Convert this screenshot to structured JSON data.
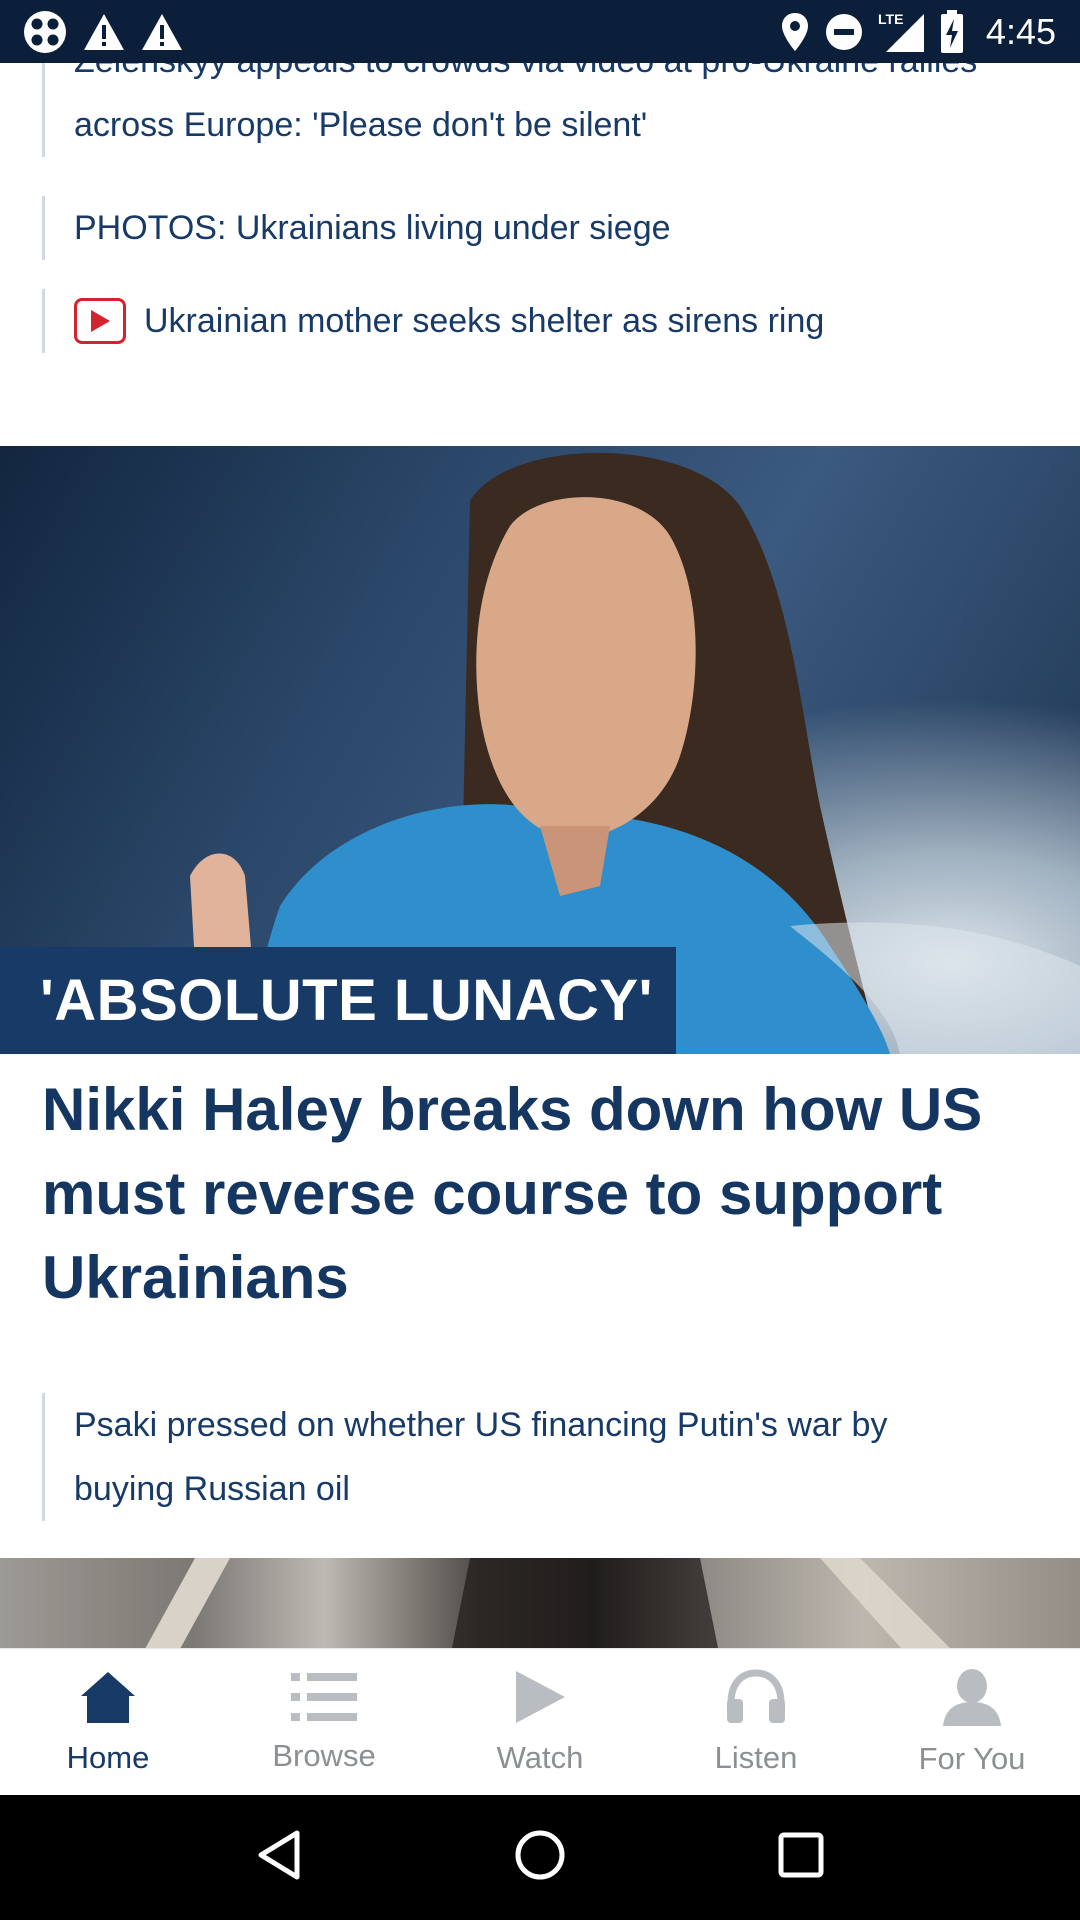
{
  "status_bar": {
    "time": "4:45",
    "network": "LTE",
    "icons": [
      "app-notification-icon",
      "warning-icon",
      "warning-icon",
      "location-icon",
      "do-not-disturb-icon",
      "signal-icon",
      "battery-charging-icon"
    ]
  },
  "related_top": [
    {
      "text": "Zelenskyy appeals to crowds via video at pro-Ukraine rallies across Europe: 'Please don't be silent'"
    },
    {
      "text": "PHOTOS: Ukrainians living under siege"
    },
    {
      "text": "Ukrainian mother seeks shelter as sirens ring",
      "icon": "video-play-icon"
    }
  ],
  "story": {
    "tag": "'ABSOLUTE LUNACY'",
    "headline": "Nikki Haley breaks down how US must reverse course to support Ukrainians",
    "related": [
      {
        "text": "Psaki pressed on whether US financing Putin's war by buying Russian oil"
      }
    ]
  },
  "bottom_nav": [
    {
      "label": "Home",
      "icon": "home-icon",
      "active": true
    },
    {
      "label": "Browse",
      "icon": "list-icon",
      "active": false
    },
    {
      "label": "Watch",
      "icon": "play-icon",
      "active": false
    },
    {
      "label": "Listen",
      "icon": "headphones-icon",
      "active": false
    },
    {
      "label": "For You",
      "icon": "person-icon",
      "active": false
    }
  ],
  "colors": {
    "brand_navy": "#173a67",
    "status_bar": "#0b1f3a",
    "video_red": "#d3232f",
    "nav_inactive": "#8c8f93"
  }
}
